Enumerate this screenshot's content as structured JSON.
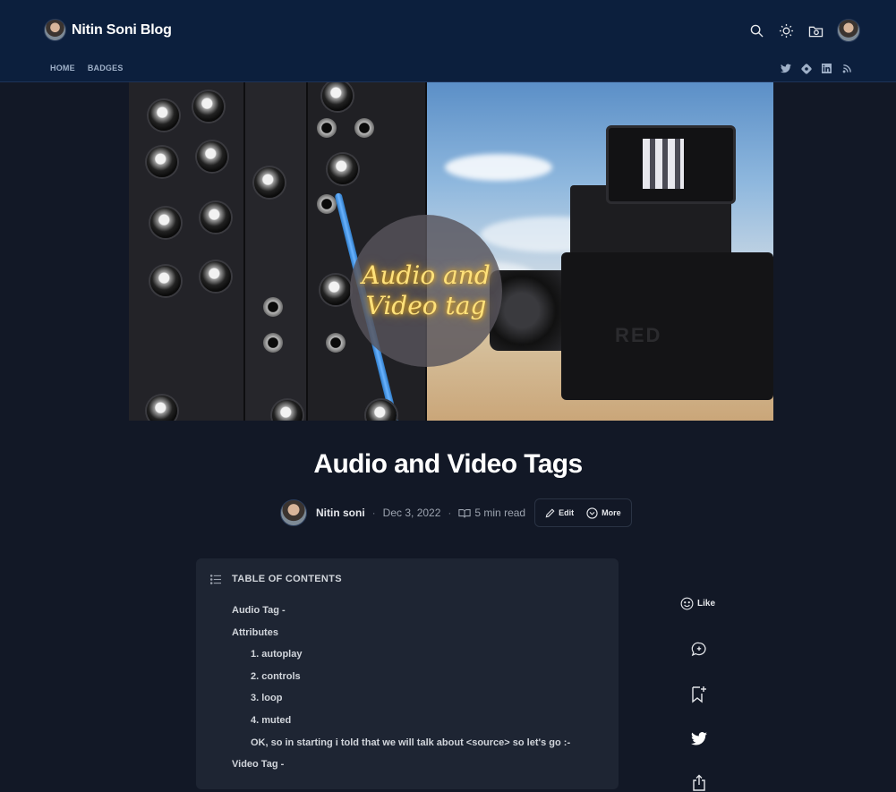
{
  "header": {
    "brand_title": "Nitin Soni Blog",
    "nav": [
      {
        "label": "HOME"
      },
      {
        "label": "BADGES"
      }
    ],
    "icons": [
      "search-icon",
      "sun-icon",
      "folder-camera-icon",
      "user-avatar"
    ],
    "social_icons": [
      "twitter-icon",
      "hashnode-icon",
      "linkedin-icon",
      "rss-icon"
    ]
  },
  "cover": {
    "overlay_text": "Audio and Video tag",
    "logo_text": "RED"
  },
  "post": {
    "title": "Audio and Video Tags",
    "author": "Nitin soni",
    "date": "Dec 3, 2022",
    "read_time": "5 min read",
    "edit_label": "Edit",
    "more_label": "More"
  },
  "toc": {
    "title": "TABLE OF CONTENTS",
    "items": [
      {
        "label": "Audio Tag -",
        "level": 1
      },
      {
        "label": "Attributes",
        "level": 1
      },
      {
        "label": "1. autoplay",
        "level": 2
      },
      {
        "label": "2. controls",
        "level": 2
      },
      {
        "label": "3. loop",
        "level": 2
      },
      {
        "label": "4. muted",
        "level": 2
      },
      {
        "label": "OK, so in starting i told that we will talk about <source> so let's go :-",
        "level": 2
      },
      {
        "label": "Video Tag -",
        "level": 1
      }
    ]
  },
  "side_actions": {
    "like_label": "Like",
    "icons": [
      "like-icon",
      "comment-icon",
      "bookmark-icon",
      "twitter-share-icon",
      "share-icon"
    ]
  },
  "colors": {
    "header_bg": "#0c1f3d",
    "page_bg": "#121826",
    "card_bg": "#1e2533",
    "overlay_text": "#ffe17a"
  }
}
